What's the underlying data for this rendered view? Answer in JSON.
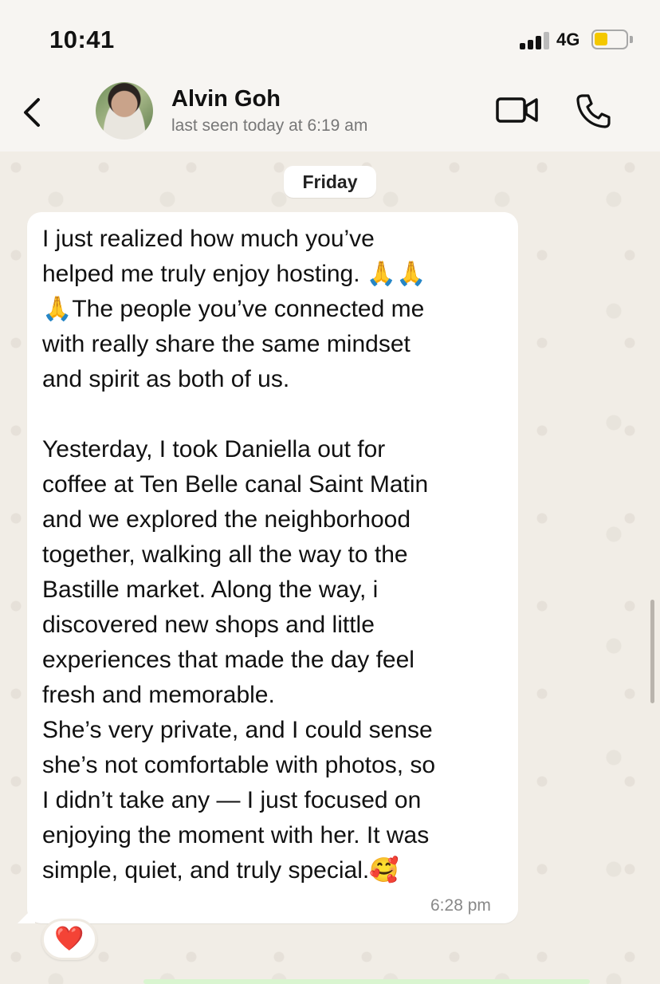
{
  "status_bar": {
    "time": "10:41",
    "network": "4G",
    "battery_level": 0.3,
    "battery_color": "#f4c800"
  },
  "header": {
    "back_icon": "chevron-left-icon",
    "contact_name": "Alvin Goh",
    "last_seen": "last seen today at 6:19 am",
    "video_icon": "video-camera-icon",
    "call_icon": "phone-icon"
  },
  "chat": {
    "date_label": "Friday",
    "messages": [
      {
        "text": "I just realized how much you’ve\nhelped me truly enjoy hosting. 🙏🙏\n🙏The people you’ve connected me\nwith really share the same mindset\nand spirit as both of us.\n\nYesterday, I took Daniella out for\ncoffee at Ten Belle canal Saint Matin\nand we explored the neighborhood\ntogether, walking all the way to the\nBastille market. Along the way, i\ndiscovered new shops and little\nexperiences that made the day feel\nfresh and memorable.\nShe’s very private, and I could sense\nshe’s not comfortable with photos, so\nI didn’t take any — I just focused on\nenjoying the moment with her. It was\nsimple, quiet, and truly special.🥰",
        "time": "6:28 pm",
        "reaction": "❤️"
      }
    ]
  }
}
